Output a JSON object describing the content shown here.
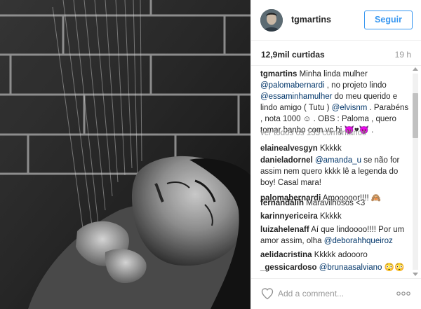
{
  "post": {
    "username": "tgmartins",
    "follow_label": "Seguir",
    "likes": "12,9mil curtidas",
    "time": "19 h"
  },
  "caption": {
    "user": "tgmartins",
    "t1": "Minha linda mulher",
    "m1": "@palomabernardi",
    "t2": ", no projeto lindo",
    "m2": "@essaminhamulher",
    "t3": "do meu querido e lindo amigo ( Tutu )",
    "m3": "@elvisnm",
    "t4": ". Parabéns , nota 1000 ☺ . OBS : Paloma , quero tomar banho com vc hj 😈♥😈 ."
  },
  "view_all": "ver todos os 133 comentários",
  "comments": [
    {
      "user": "elainealvesgyn",
      "text": "Kkkkk"
    },
    {
      "user": "danieladornel",
      "mention": "@amanda_u",
      "text": "se não for assim nem quero kkkk lê a legenda do boy! Casal mara!"
    },
    {
      "user": "palomabernardi",
      "text": "Amooooor!!!! 🙈"
    },
    {
      "user": "fernandalih",
      "text": "Maravilhosos <3"
    },
    {
      "user": "karinnyericeira",
      "text": "Kkkkk"
    },
    {
      "user": "luizahelenaff",
      "text": "Aí que lindoooo!!!! Por um amor assim, olha",
      "mention": "@deborahhqueiroz"
    },
    {
      "user": "aelidacristina",
      "text": "Kkkkk adoooro"
    },
    {
      "user": "_gessicardoso",
      "mention": "@brunaasalviano",
      "text": "😳😳"
    }
  ],
  "footer": {
    "placeholder": "Add a comment..."
  },
  "icons": {
    "heart": "heart-outline-icon",
    "more": "ellipsis-icon"
  },
  "colors": {
    "accent": "#3897f0",
    "mention": "#003569",
    "muted": "#999999"
  }
}
